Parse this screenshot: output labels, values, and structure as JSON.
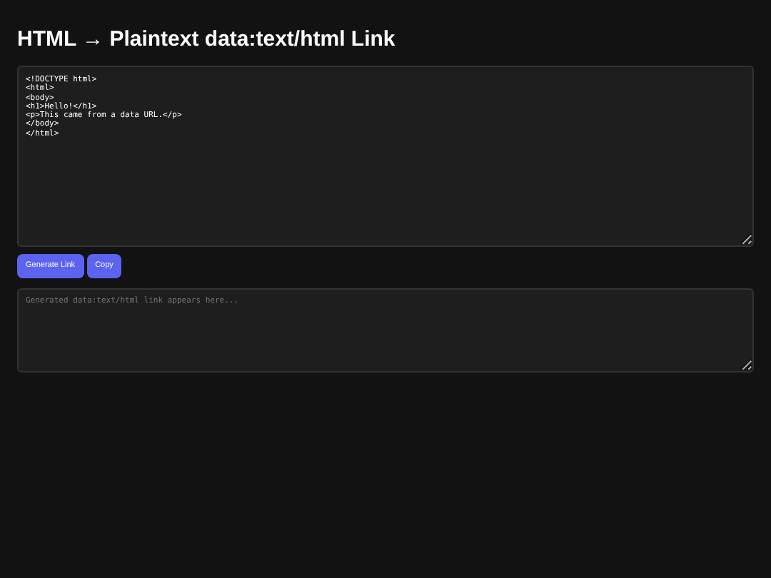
{
  "title": "HTML → Plaintext data:text/html Link",
  "html_input": {
    "value": "<!DOCTYPE html>\n<html>\n<body>\n<h1>Hello!</h1>\n<p>This came from a data URL.</p>\n</body>\n</html>"
  },
  "buttons": [
    "Generate Link",
    "Copy"
  ],
  "output": {
    "placeholder": "Generated data:text/html link appears here..."
  }
}
